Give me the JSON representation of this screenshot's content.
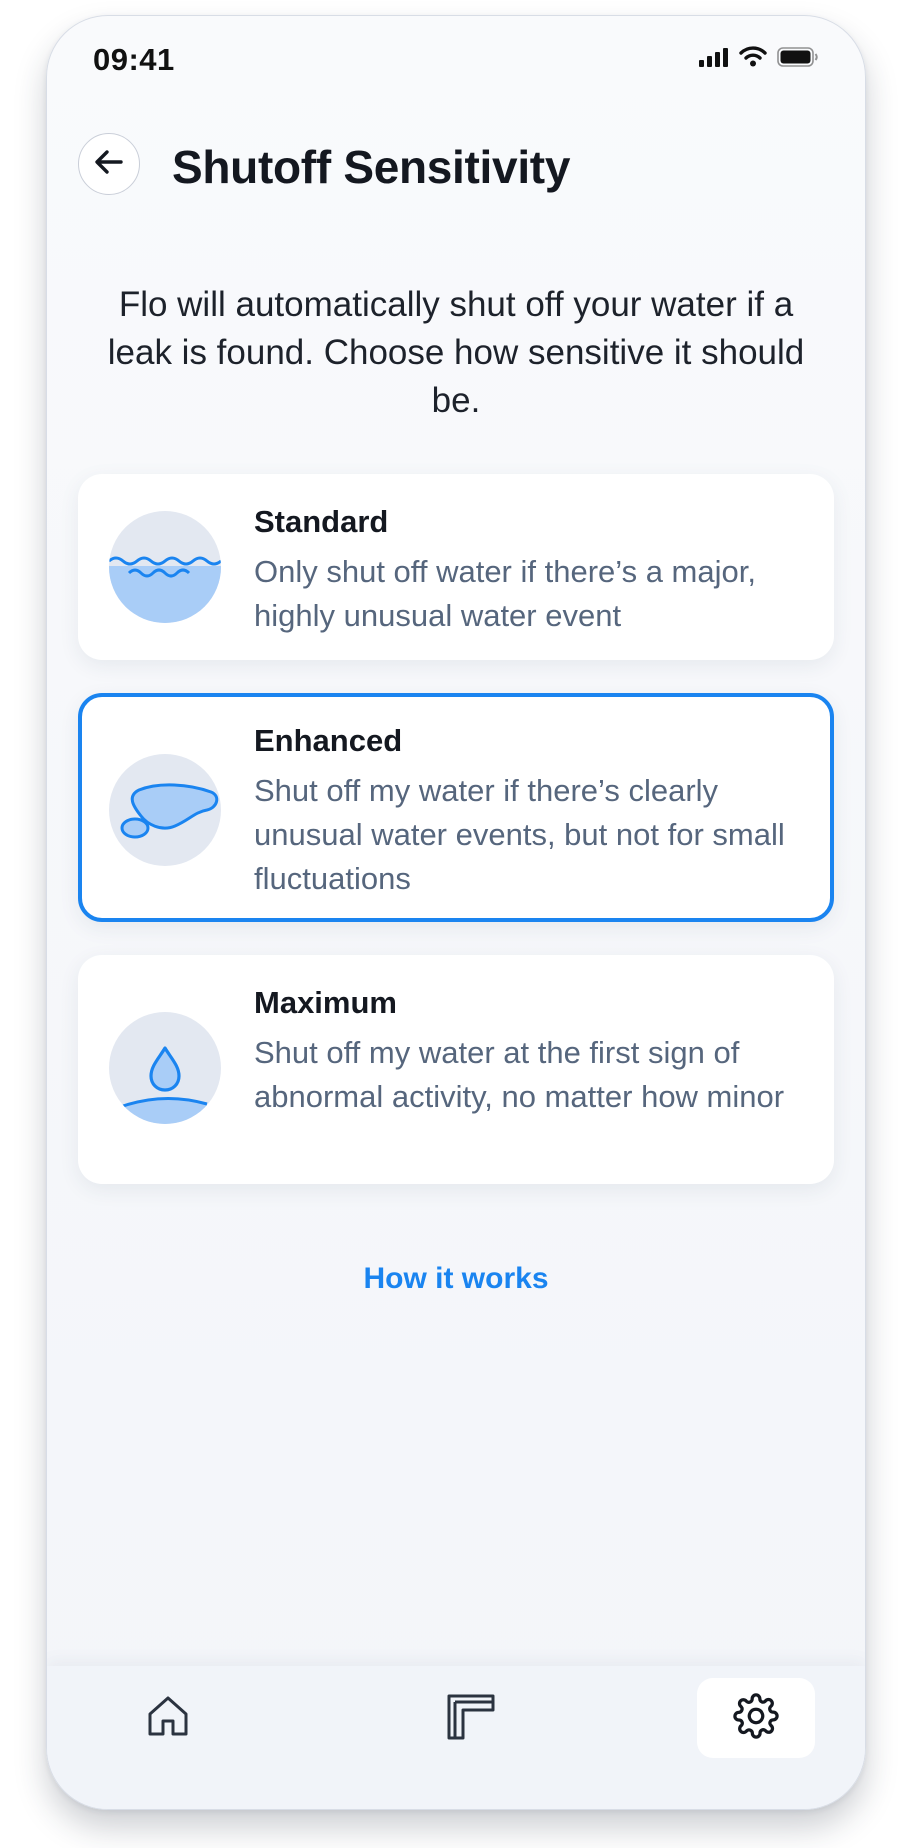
{
  "status_bar": {
    "time": "09:41",
    "icons": [
      "signal-icon",
      "wifi-icon",
      "battery-icon"
    ]
  },
  "header": {
    "back_icon": "arrow-left-icon",
    "title": "Shutoff Sensitivity"
  },
  "intro_text": "Flo will automatically shut off your water if a leak is found. Choose how sensitive it should be.",
  "options": [
    {
      "name": "Standard",
      "description": "Only shut off water if there’s a major, highly unusual water event",
      "icon": "water-waves-icon",
      "selected": false
    },
    {
      "name": "Enhanced",
      "description": "Shut off my water if there’s clearly unusual water events, but not for small fluctuations",
      "icon": "water-puddle-icon",
      "selected": true
    },
    {
      "name": "Maximum",
      "description": "Shut off my water at the first sign of abnormal activity, no matter how minor",
      "icon": "water-drop-icon",
      "selected": false
    }
  ],
  "how_it_works_label": "How it works",
  "tab_bar": {
    "tabs": [
      {
        "icon": "home-icon",
        "active": false
      },
      {
        "icon": "device-icon",
        "active": false
      },
      {
        "icon": "gear-icon",
        "active": true
      }
    ]
  },
  "colors": {
    "accent": "#1a84f0",
    "text_primary": "#141820",
    "text_secondary": "#56667d",
    "icon_circle": "#e3e8f1",
    "water_fill": "#a9cdf7"
  }
}
